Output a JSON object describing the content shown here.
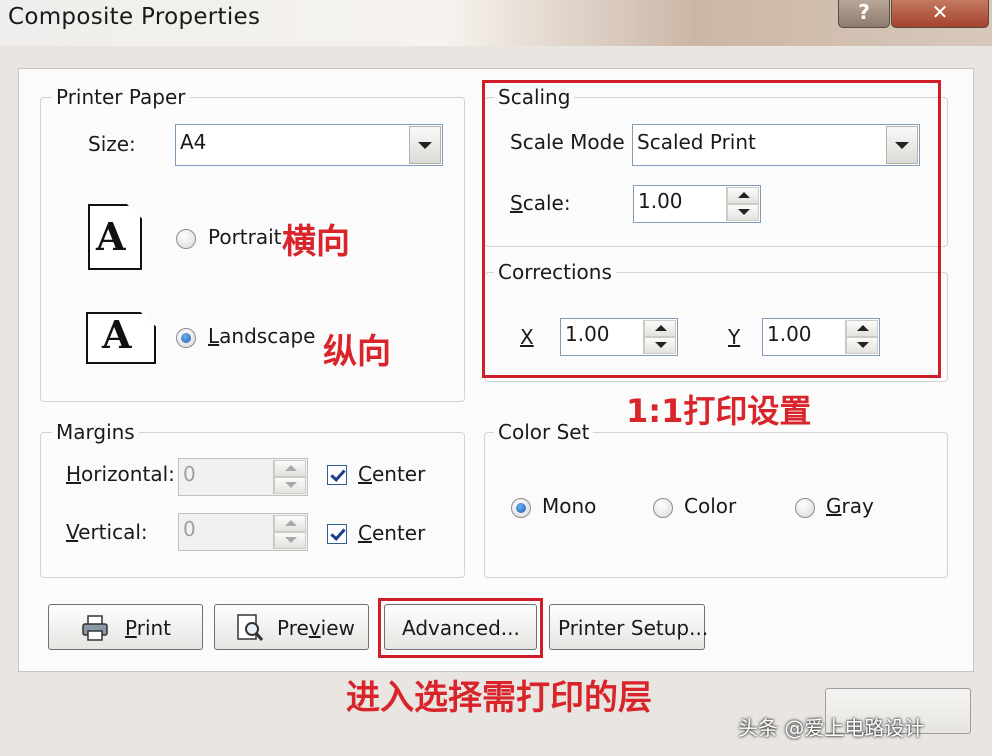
{
  "window": {
    "title": "Composite Properties",
    "help_glyph": "?",
    "close_glyph": "✕"
  },
  "printer_paper": {
    "group_label": "Printer Paper",
    "size_label": "Size:",
    "size_value": "A4",
    "page_glyph": "A",
    "portrait_label": "Portrait",
    "landscape_label": "Landscape",
    "orientation_selected": "Landscape"
  },
  "scaling": {
    "group_label": "Scaling",
    "scale_mode_label": "Scale Mode",
    "scale_mode_value": "Scaled Print",
    "scale_label": "Scale:",
    "scale_value": "1.00",
    "corrections_label": "Corrections",
    "x_label": "X",
    "x_value": "1.00",
    "y_label": "Y",
    "y_value": "1.00"
  },
  "margins": {
    "group_label": "Margins",
    "horizontal_label": "Horizontal:",
    "horizontal_value": "0",
    "horizontal_center_label": "Center",
    "horizontal_center_checked": true,
    "vertical_label": "Vertical:",
    "vertical_value": "0",
    "vertical_center_label": "Center",
    "vertical_center_checked": true
  },
  "color_set": {
    "group_label": "Color Set",
    "mono_label": "Mono",
    "color_label": "Color",
    "gray_label": "Gray",
    "selected": "Mono"
  },
  "buttons": {
    "print_label": "Print",
    "preview_label": "Preview",
    "advanced_label": "Advanced...",
    "printer_setup_label": "Printer Setup..."
  },
  "annotations": {
    "portrait_note": "横向",
    "landscape_note": "纵向",
    "scaling_note": "1:1打印设置",
    "advanced_note": "进入选择需打印的层",
    "watermark": "头条 @爱上电路设计"
  },
  "colors": {
    "annotation_red": "#d8242a",
    "window_frame": "#e9e6e1",
    "client_bg": "#fbfbfb",
    "selected_radio": "#1a5fb0"
  }
}
